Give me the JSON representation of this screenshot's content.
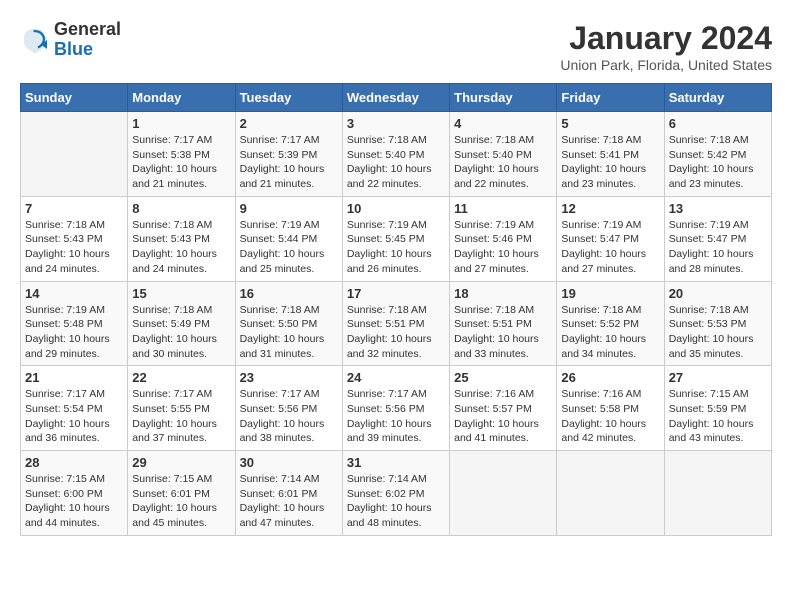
{
  "logo": {
    "general": "General",
    "blue": "Blue"
  },
  "header": {
    "title": "January 2024",
    "subtitle": "Union Park, Florida, United States"
  },
  "calendar": {
    "days_of_week": [
      "Sunday",
      "Monday",
      "Tuesday",
      "Wednesday",
      "Thursday",
      "Friday",
      "Saturday"
    ],
    "weeks": [
      [
        {
          "day": "",
          "info": ""
        },
        {
          "day": "1",
          "info": "Sunrise: 7:17 AM\nSunset: 5:38 PM\nDaylight: 10 hours\nand 21 minutes."
        },
        {
          "day": "2",
          "info": "Sunrise: 7:17 AM\nSunset: 5:39 PM\nDaylight: 10 hours\nand 21 minutes."
        },
        {
          "day": "3",
          "info": "Sunrise: 7:18 AM\nSunset: 5:40 PM\nDaylight: 10 hours\nand 22 minutes."
        },
        {
          "day": "4",
          "info": "Sunrise: 7:18 AM\nSunset: 5:40 PM\nDaylight: 10 hours\nand 22 minutes."
        },
        {
          "day": "5",
          "info": "Sunrise: 7:18 AM\nSunset: 5:41 PM\nDaylight: 10 hours\nand 23 minutes."
        },
        {
          "day": "6",
          "info": "Sunrise: 7:18 AM\nSunset: 5:42 PM\nDaylight: 10 hours\nand 23 minutes."
        }
      ],
      [
        {
          "day": "7",
          "info": "Sunrise: 7:18 AM\nSunset: 5:43 PM\nDaylight: 10 hours\nand 24 minutes."
        },
        {
          "day": "8",
          "info": "Sunrise: 7:18 AM\nSunset: 5:43 PM\nDaylight: 10 hours\nand 24 minutes."
        },
        {
          "day": "9",
          "info": "Sunrise: 7:19 AM\nSunset: 5:44 PM\nDaylight: 10 hours\nand 25 minutes."
        },
        {
          "day": "10",
          "info": "Sunrise: 7:19 AM\nSunset: 5:45 PM\nDaylight: 10 hours\nand 26 minutes."
        },
        {
          "day": "11",
          "info": "Sunrise: 7:19 AM\nSunset: 5:46 PM\nDaylight: 10 hours\nand 27 minutes."
        },
        {
          "day": "12",
          "info": "Sunrise: 7:19 AM\nSunset: 5:47 PM\nDaylight: 10 hours\nand 27 minutes."
        },
        {
          "day": "13",
          "info": "Sunrise: 7:19 AM\nSunset: 5:47 PM\nDaylight: 10 hours\nand 28 minutes."
        }
      ],
      [
        {
          "day": "14",
          "info": "Sunrise: 7:19 AM\nSunset: 5:48 PM\nDaylight: 10 hours\nand 29 minutes."
        },
        {
          "day": "15",
          "info": "Sunrise: 7:18 AM\nSunset: 5:49 PM\nDaylight: 10 hours\nand 30 minutes."
        },
        {
          "day": "16",
          "info": "Sunrise: 7:18 AM\nSunset: 5:50 PM\nDaylight: 10 hours\nand 31 minutes."
        },
        {
          "day": "17",
          "info": "Sunrise: 7:18 AM\nSunset: 5:51 PM\nDaylight: 10 hours\nand 32 minutes."
        },
        {
          "day": "18",
          "info": "Sunrise: 7:18 AM\nSunset: 5:51 PM\nDaylight: 10 hours\nand 33 minutes."
        },
        {
          "day": "19",
          "info": "Sunrise: 7:18 AM\nSunset: 5:52 PM\nDaylight: 10 hours\nand 34 minutes."
        },
        {
          "day": "20",
          "info": "Sunrise: 7:18 AM\nSunset: 5:53 PM\nDaylight: 10 hours\nand 35 minutes."
        }
      ],
      [
        {
          "day": "21",
          "info": "Sunrise: 7:17 AM\nSunset: 5:54 PM\nDaylight: 10 hours\nand 36 minutes."
        },
        {
          "day": "22",
          "info": "Sunrise: 7:17 AM\nSunset: 5:55 PM\nDaylight: 10 hours\nand 37 minutes."
        },
        {
          "day": "23",
          "info": "Sunrise: 7:17 AM\nSunset: 5:56 PM\nDaylight: 10 hours\nand 38 minutes."
        },
        {
          "day": "24",
          "info": "Sunrise: 7:17 AM\nSunset: 5:56 PM\nDaylight: 10 hours\nand 39 minutes."
        },
        {
          "day": "25",
          "info": "Sunrise: 7:16 AM\nSunset: 5:57 PM\nDaylight: 10 hours\nand 41 minutes."
        },
        {
          "day": "26",
          "info": "Sunrise: 7:16 AM\nSunset: 5:58 PM\nDaylight: 10 hours\nand 42 minutes."
        },
        {
          "day": "27",
          "info": "Sunrise: 7:15 AM\nSunset: 5:59 PM\nDaylight: 10 hours\nand 43 minutes."
        }
      ],
      [
        {
          "day": "28",
          "info": "Sunrise: 7:15 AM\nSunset: 6:00 PM\nDaylight: 10 hours\nand 44 minutes."
        },
        {
          "day": "29",
          "info": "Sunrise: 7:15 AM\nSunset: 6:01 PM\nDaylight: 10 hours\nand 45 minutes."
        },
        {
          "day": "30",
          "info": "Sunrise: 7:14 AM\nSunset: 6:01 PM\nDaylight: 10 hours\nand 47 minutes."
        },
        {
          "day": "31",
          "info": "Sunrise: 7:14 AM\nSunset: 6:02 PM\nDaylight: 10 hours\nand 48 minutes."
        },
        {
          "day": "",
          "info": ""
        },
        {
          "day": "",
          "info": ""
        },
        {
          "day": "",
          "info": ""
        }
      ]
    ]
  }
}
